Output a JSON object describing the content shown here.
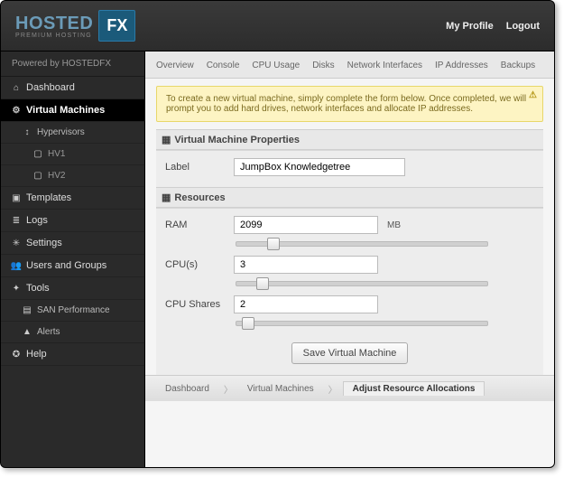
{
  "header": {
    "logo_main": "HOSTED",
    "logo_sub": "PREMIUM HOSTING",
    "logo_badge": "FX",
    "profile_link": "My Profile",
    "logout_link": "Logout"
  },
  "sidebar": {
    "powered_by": "Powered by  HOSTEDFX",
    "items": [
      {
        "icon": "⌂",
        "label": "Dashboard"
      },
      {
        "icon": "⚙",
        "label": "Virtual Machines"
      },
      {
        "icon": "↕",
        "label": "Hypervisors"
      },
      {
        "icon": "▢",
        "label": "HV1"
      },
      {
        "icon": "▢",
        "label": "HV2"
      },
      {
        "icon": "▣",
        "label": "Templates"
      },
      {
        "icon": "≣",
        "label": "Logs"
      },
      {
        "icon": "✳",
        "label": "Settings"
      },
      {
        "icon": "👥",
        "label": "Users and Groups"
      },
      {
        "icon": "✦",
        "label": "Tools"
      },
      {
        "icon": "▤",
        "label": "SAN Performance"
      },
      {
        "icon": "▲",
        "label": "Alerts"
      },
      {
        "icon": "✪",
        "label": "Help"
      }
    ]
  },
  "tabs": [
    "Overview",
    "Console",
    "CPU Usage",
    "Disks",
    "Network Interfaces",
    "IP Addresses",
    "Backups"
  ],
  "notice": "To create a new virtual machine, simply complete the form below. Once completed, we will prompt you to add hard drives, network interfaces and allocate IP addresses.",
  "notice_icon": "⚠",
  "sections": {
    "props_title": "Virtual Machine Properties",
    "resources_title": "Resources"
  },
  "form": {
    "label": {
      "label": "Label",
      "value": "JumpBox Knowledgetree"
    },
    "ram": {
      "label": "RAM",
      "value": "2099",
      "unit": "MB"
    },
    "cpus": {
      "label": "CPU(s)",
      "value": "3"
    },
    "cpu_shares": {
      "label": "CPU Shares",
      "value": "2"
    },
    "save_button": "Save Virtual Machine"
  },
  "breadcrumb": {
    "items": [
      "Dashboard",
      "Virtual Machines",
      "Adjust Resource Allocations"
    ]
  }
}
